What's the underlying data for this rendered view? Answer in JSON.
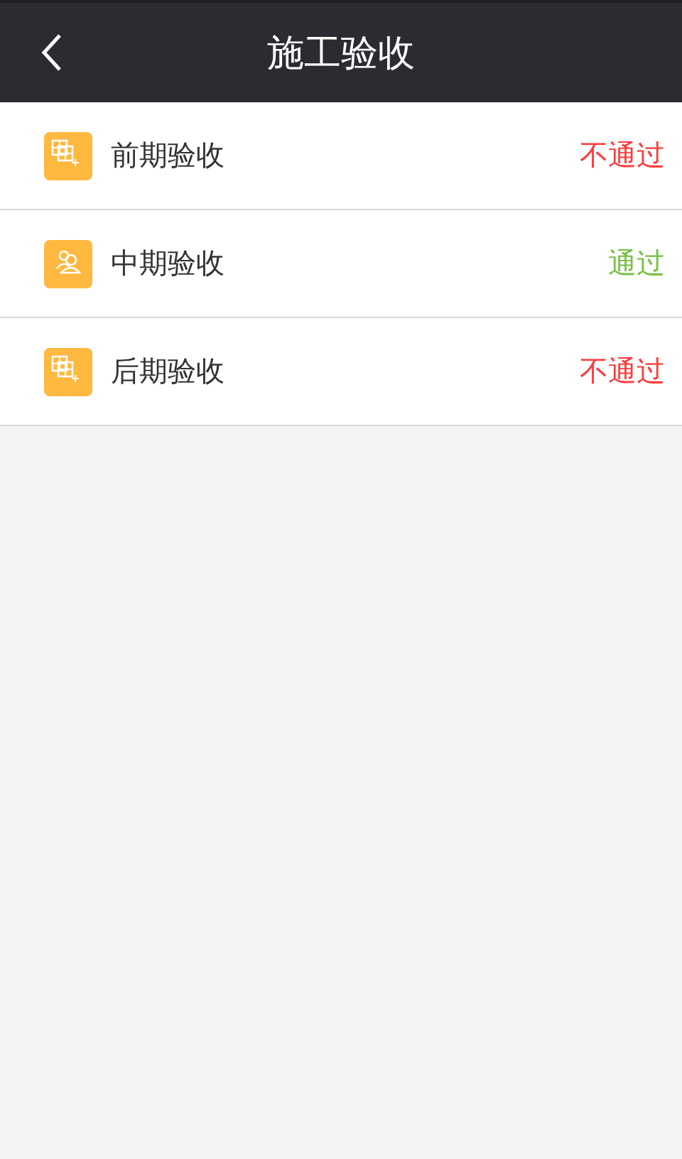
{
  "header": {
    "title": "施工验收"
  },
  "items": [
    {
      "label": "前期验收",
      "kind": "grid",
      "status": "不通过",
      "passed": false
    },
    {
      "label": "中期验收",
      "kind": "people",
      "status": "通过",
      "passed": true
    },
    {
      "label": "后期验收",
      "kind": "grid",
      "status": "不通过",
      "passed": false
    }
  ]
}
